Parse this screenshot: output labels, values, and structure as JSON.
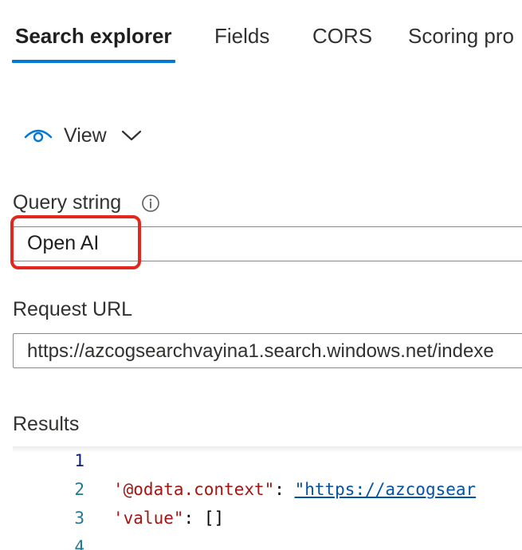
{
  "tabs": [
    {
      "label": "Search explorer",
      "active": true
    },
    {
      "label": "Fields",
      "active": false
    },
    {
      "label": "CORS",
      "active": false
    },
    {
      "label": "Scoring pro",
      "active": false
    }
  ],
  "view_button": {
    "label": "View",
    "icon": "eye-icon",
    "chevron": "chevron-down-icon"
  },
  "query": {
    "label": "Query string",
    "info_icon": "info-icon",
    "value": "Open AI"
  },
  "request_url": {
    "label": "Request URL",
    "value": "https://azcogsearchvayina1.search.windows.net/indexe"
  },
  "results": {
    "label": "Results",
    "line_numbers": [
      "1",
      "2",
      "3",
      "4"
    ],
    "lines": [
      {
        "key": "",
        "sep": "",
        "value": ""
      },
      {
        "key": "'@odata.context\"",
        "sep": ": ",
        "value": "\"https://azcogsear"
      },
      {
        "key": "'value\"",
        "sep": ": ",
        "value": "[]"
      },
      {
        "key": "",
        "sep": "",
        "value": ""
      }
    ]
  },
  "colors": {
    "accent": "#0078d4",
    "highlight": "#e0281f",
    "json_key": "#a31515",
    "json_string": "#0451a5",
    "line_number": "#237893"
  }
}
